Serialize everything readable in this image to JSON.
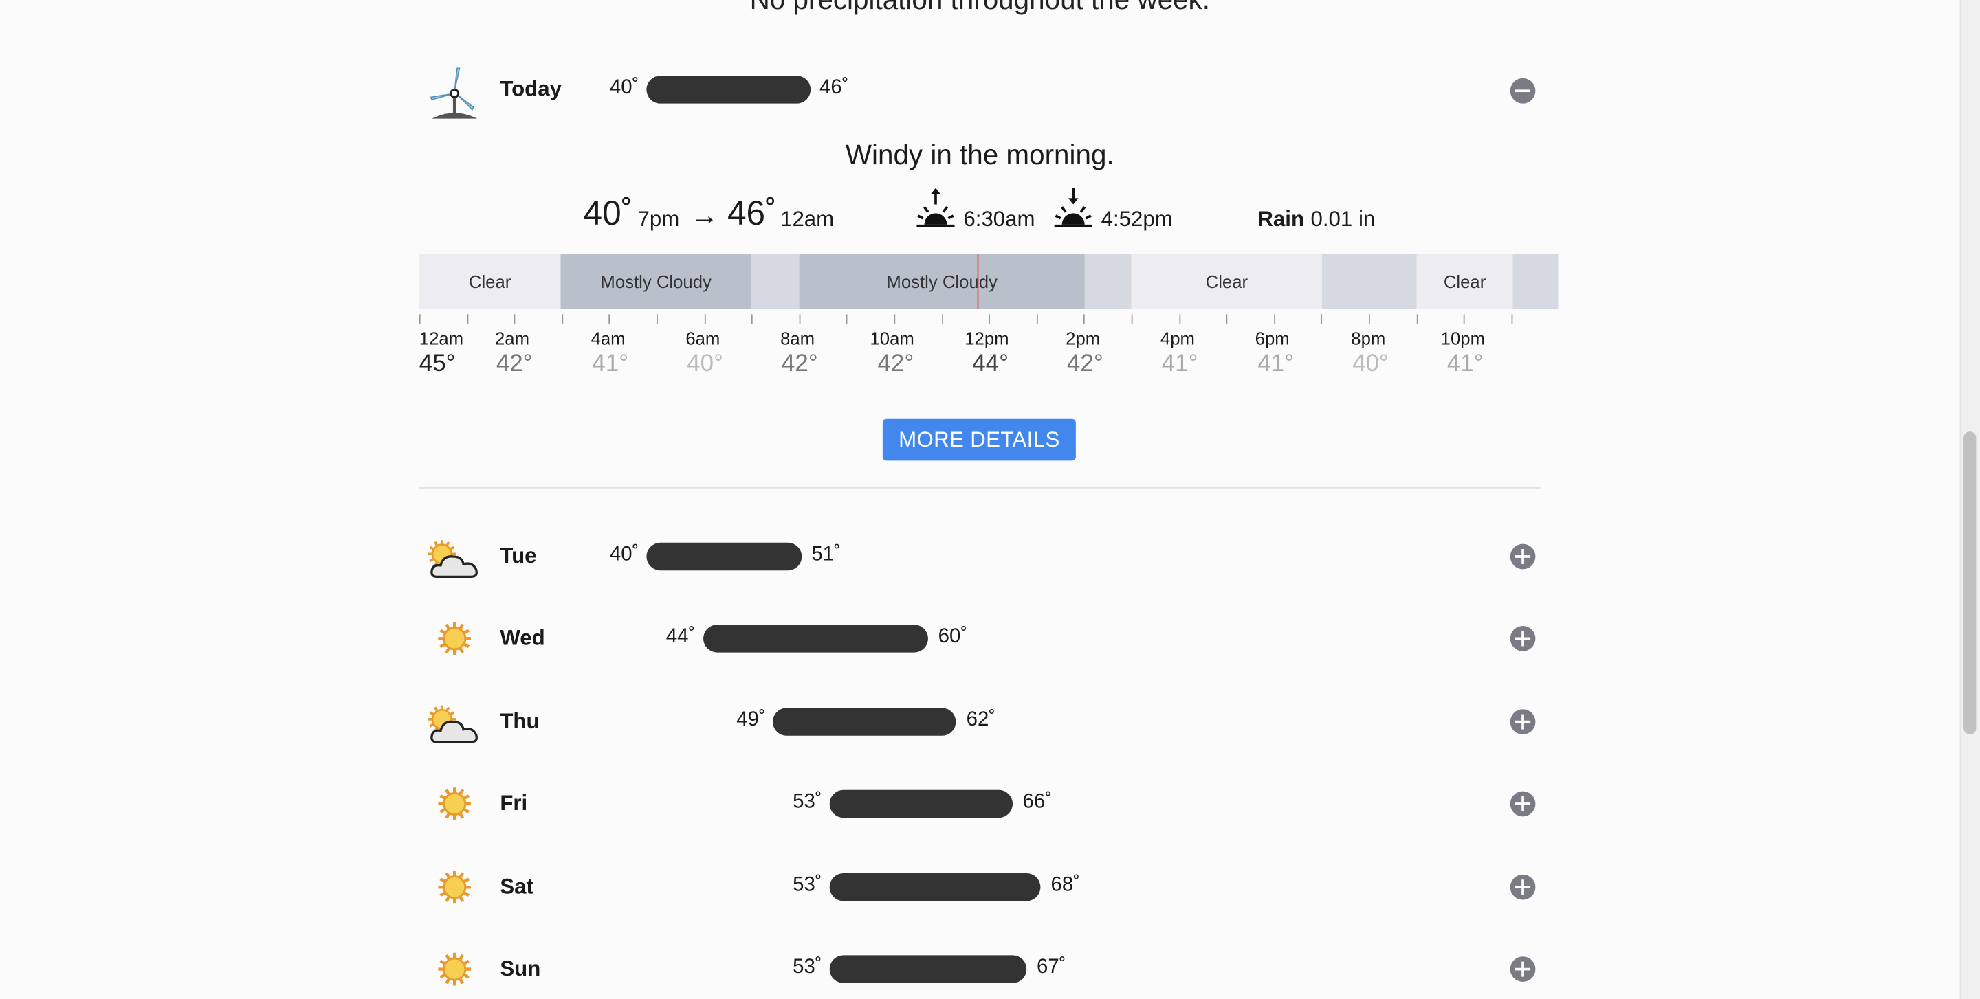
{
  "week_summary": "No precipitation throughout the week.",
  "today": {
    "label": "Today",
    "icon": "wind-turbine-icon",
    "low": "40˚",
    "high": "46˚",
    "low_value": 40,
    "high_value": 46,
    "summary": "Windy in the morning.",
    "low_temp": "40˚",
    "low_time": "7pm",
    "arrow": "→",
    "high_temp": "46˚",
    "high_time": "12am",
    "sunrise": "6:30am",
    "sunset": "4:52pm",
    "rain_label": "Rain",
    "rain_value": "0.01 in",
    "conditions": [
      "Clear",
      "Mostly Cloudy",
      "Mostly Cloudy",
      "Clear",
      "Clear"
    ],
    "hours": [
      "12am",
      "2am",
      "4am",
      "6am",
      "8am",
      "10am",
      "12pm",
      "2pm",
      "4pm",
      "6pm",
      "8pm",
      "10pm"
    ],
    "hour_temps": [
      "45°",
      "42°",
      "41°",
      "40°",
      "42°",
      "42°",
      "44°",
      "42°",
      "41°",
      "41°",
      "40°",
      "41°"
    ],
    "button_label": "MORE DETAILS",
    "toggle_icon": "minus-circle-icon"
  },
  "days": [
    {
      "name": "Tue",
      "icon": "partly-cloudy-icon",
      "low": "40˚",
      "high": "51˚",
      "low_value": 40,
      "high_value": 51
    },
    {
      "name": "Wed",
      "icon": "sun-icon",
      "low": "44˚",
      "high": "60˚",
      "low_value": 44,
      "high_value": 60
    },
    {
      "name": "Thu",
      "icon": "partly-cloudy-icon",
      "low": "49˚",
      "high": "62˚",
      "low_value": 49,
      "high_value": 62
    },
    {
      "name": "Fri",
      "icon": "sun-icon",
      "low": "53˚",
      "high": "66˚",
      "low_value": 53,
      "high_value": 66
    },
    {
      "name": "Sat",
      "icon": "sun-icon",
      "low": "53˚",
      "high": "68˚",
      "low_value": 53,
      "high_value": 68
    },
    {
      "name": "Sun",
      "icon": "sun-icon",
      "low": "53˚",
      "high": "67˚",
      "low_value": 53,
      "high_value": 67
    }
  ],
  "colors": {
    "bar": "#333333",
    "button": "#4287ee",
    "clear_segment": "#ededf1",
    "cloudy_segment": "#b9bfcb",
    "partly_segment": "#d6d9e1",
    "now_line": "#e05050",
    "sun": "#f5b731",
    "toggle": "#7b7b85"
  }
}
